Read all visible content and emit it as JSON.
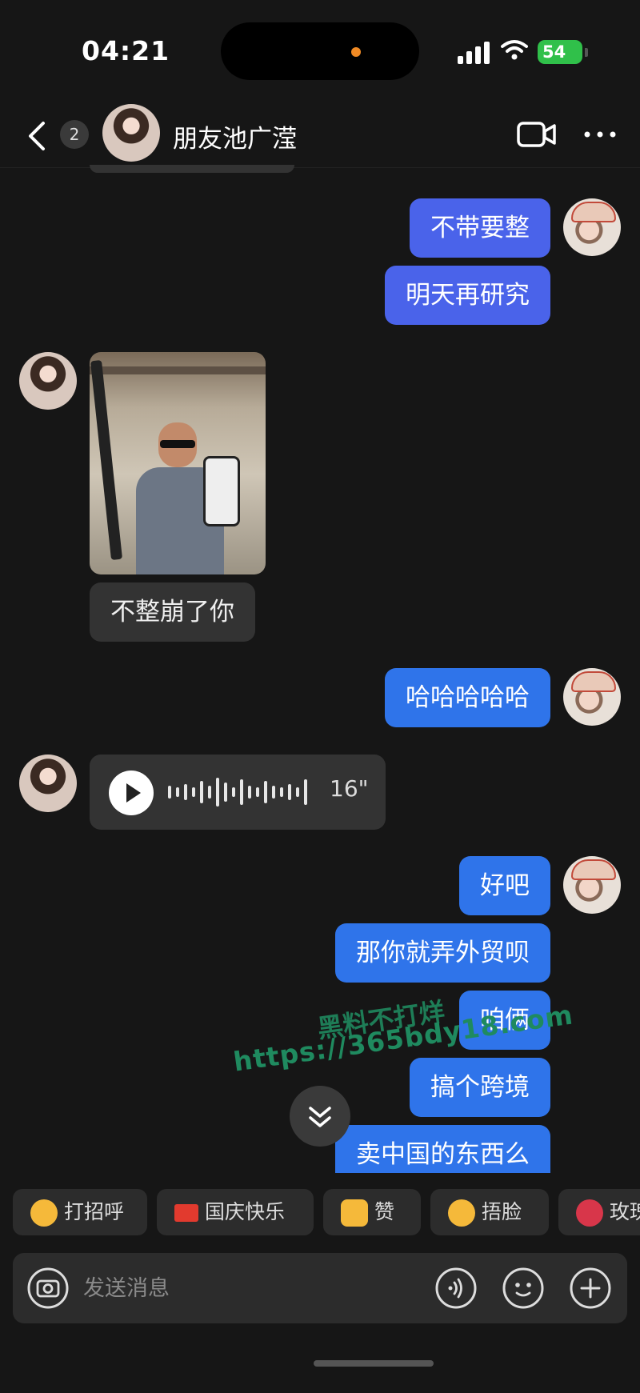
{
  "status_bar": {
    "time": "04:21",
    "battery": "54"
  },
  "header": {
    "unread_count": "2",
    "contact_name": "朋友池广滢"
  },
  "messages": [
    {
      "from": "me",
      "text": "不带要整"
    },
    {
      "from": "me",
      "text": "明天再研究"
    },
    {
      "from": "her",
      "type": "image"
    },
    {
      "from": "her",
      "text": "不整崩了你"
    },
    {
      "from": "me",
      "text": "哈哈哈哈哈"
    },
    {
      "from": "her",
      "type": "voice",
      "duration": "16\""
    },
    {
      "from": "me",
      "text": "好吧"
    },
    {
      "from": "me",
      "text": "那你就弄外贸呗"
    },
    {
      "from": "me",
      "text": "咱俩"
    },
    {
      "from": "me",
      "text": "搞个跨境"
    },
    {
      "from": "me",
      "text": "卖中国的东西么"
    }
  ],
  "watermark": {
    "line1": "黑料不打烊",
    "line2": "https://365bdy18.com"
  },
  "quick_replies": [
    {
      "label": "打招呼",
      "icon": "waving-face-icon",
      "color": "#f5b93a"
    },
    {
      "label": "国庆快乐",
      "icon": "red-flag-icon",
      "color": "#e23a2e"
    },
    {
      "label": "赞",
      "icon": "thumbs-up-icon",
      "color": "#f5b93a"
    },
    {
      "label": "捂脸",
      "icon": "facepalm-icon",
      "color": "#f5b93a"
    },
    {
      "label": "玫瑰",
      "icon": "rose-icon",
      "color": "#d8364a"
    }
  ],
  "input": {
    "placeholder": "发送消息"
  },
  "colors": {
    "my_bubble": "#2f74ea",
    "my_bubble_alt": "#4a63ea",
    "her_bubble": "#333333",
    "background": "#161616"
  }
}
